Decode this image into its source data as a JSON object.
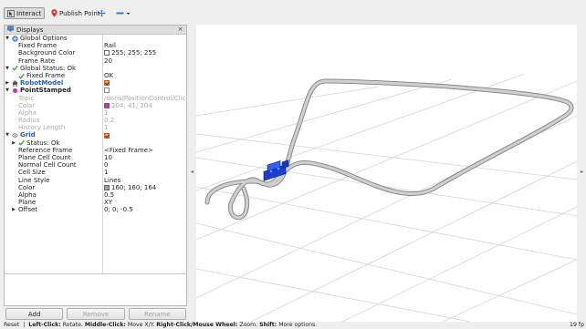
{
  "toolbar": {
    "interact_label": "Interact",
    "publish_point_label": "Publish Point"
  },
  "displays_panel": {
    "title": "Displays",
    "rows": [
      {
        "name": "Global Options",
        "value": "",
        "indent": 0,
        "arrow": "▼",
        "icon": "gear-icon",
        "style": ""
      },
      {
        "name": "Fixed Frame",
        "value": "Rail",
        "indent": 1,
        "arrow": "",
        "icon": "",
        "style": ""
      },
      {
        "name": "Background Color",
        "value": "255; 255; 255",
        "indent": 1,
        "arrow": "",
        "icon": "",
        "style": "",
        "swatch": "#ffffff"
      },
      {
        "name": "Frame Rate",
        "value": "20",
        "indent": 1,
        "arrow": "",
        "icon": "",
        "style": ""
      },
      {
        "name": "Global Status: Ok",
        "value": "",
        "indent": 0,
        "arrow": "▼",
        "icon": "check-icon",
        "style": ""
      },
      {
        "name": "Fixed Frame",
        "value": "OK",
        "indent": 1,
        "arrow": "",
        "icon": "check-icon",
        "style": ""
      },
      {
        "name": "RobotModel",
        "value": "",
        "indent": 0,
        "arrow": "▶",
        "icon": "robot-icon",
        "style": "blue",
        "checkbox": true
      },
      {
        "name": "PointStamped",
        "value": "",
        "indent": 0,
        "arrow": "▼",
        "icon": "point-icon",
        "style": "bold",
        "checkbox": false
      },
      {
        "name": "Topic",
        "value": "/doris/PositionControl/Clic...",
        "indent": 1,
        "arrow": "",
        "icon": "",
        "style": "dim"
      },
      {
        "name": "Color",
        "value": "204; 41; 204",
        "indent": 1,
        "arrow": "",
        "icon": "",
        "style": "dim",
        "swatch": "#cc29cc"
      },
      {
        "name": "Alpha",
        "value": "1",
        "indent": 1,
        "arrow": "",
        "icon": "",
        "style": "dim"
      },
      {
        "name": "Radius",
        "value": "0.2",
        "indent": 1,
        "arrow": "",
        "icon": "",
        "style": "dim"
      },
      {
        "name": "History Length",
        "value": "1",
        "indent": 1,
        "arrow": "",
        "icon": "",
        "style": "dim"
      },
      {
        "name": "Grid",
        "value": "",
        "indent": 0,
        "arrow": "▼",
        "icon": "grid-icon",
        "style": "blue",
        "checkbox": true
      },
      {
        "name": "Status: Ok",
        "value": "",
        "indent": 1,
        "arrow": "▶",
        "icon": "check-icon",
        "style": ""
      },
      {
        "name": "Reference Frame",
        "value": "<Fixed Frame>",
        "indent": 1,
        "arrow": "",
        "icon": "",
        "style": ""
      },
      {
        "name": "Plane Cell Count",
        "value": "10",
        "indent": 1,
        "arrow": "",
        "icon": "",
        "style": ""
      },
      {
        "name": "Normal Cell Count",
        "value": "0",
        "indent": 1,
        "arrow": "",
        "icon": "",
        "style": ""
      },
      {
        "name": "Cell Size",
        "value": "1",
        "indent": 1,
        "arrow": "",
        "icon": "",
        "style": ""
      },
      {
        "name": "Line Style",
        "value": "Lines",
        "indent": 1,
        "arrow": "",
        "icon": "",
        "style": ""
      },
      {
        "name": "Color",
        "value": "160; 160; 164",
        "indent": 1,
        "arrow": "",
        "icon": "",
        "style": "",
        "swatch": "#a0a0a4"
      },
      {
        "name": "Alpha",
        "value": "0.5",
        "indent": 1,
        "arrow": "",
        "icon": "",
        "style": ""
      },
      {
        "name": "Plane",
        "value": "XY",
        "indent": 1,
        "arrow": "",
        "icon": "",
        "style": ""
      },
      {
        "name": "Offset",
        "value": "0; 0; -0.5",
        "indent": 1,
        "arrow": "▶",
        "icon": "",
        "style": ""
      }
    ]
  },
  "buttons": {
    "add": "Add",
    "remove": "Remove",
    "rename": "Rename"
  },
  "statusbar": {
    "reset": "Reset",
    "left_key": "Left-Click:",
    "left_action": "Rotate.",
    "middle_key": "Middle-Click:",
    "middle_action": "Move X/Y.",
    "right_key": "Right-Click/Mouse Wheel:",
    "right_action": "Zoom.",
    "shift_key": "Shift:",
    "shift_action": "More options.",
    "fps": "19 fp"
  },
  "colors": {
    "accent_blue": "#1f5fb8",
    "robot_blue": "#1c3fd0",
    "rail_gray": "#a8a8a8",
    "grid_gray": "#d2d2d2"
  }
}
